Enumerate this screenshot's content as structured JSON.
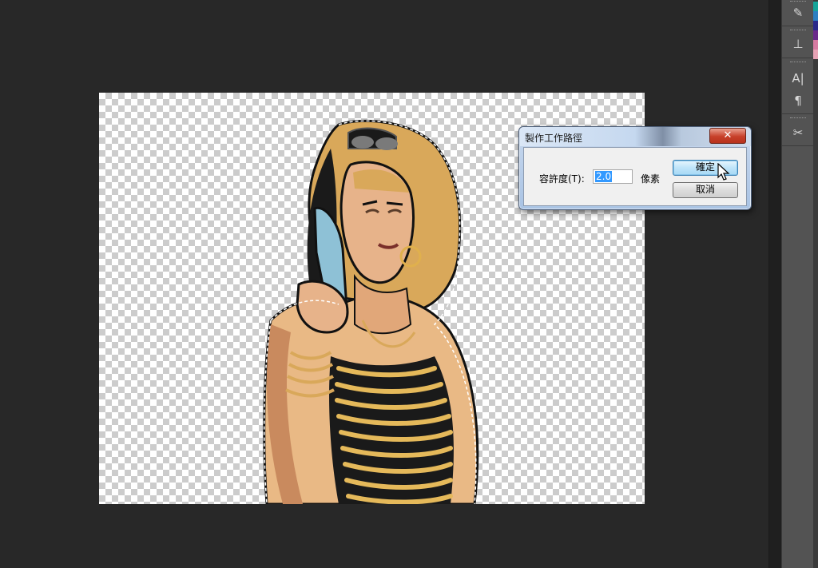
{
  "dialog": {
    "title": "製作工作路徑",
    "close_glyph": "✕",
    "tolerance_label": "容許度(T):",
    "tolerance_value": "2.0",
    "unit": "像素",
    "ok_label": "確定",
    "cancel_label": "取消"
  },
  "dock": {
    "tools": [
      {
        "icon": "brush-presets-icon",
        "glyph": "✎"
      },
      {
        "icon": "clone-source-icon",
        "glyph": "⊥"
      },
      {
        "icon": "character-icon",
        "glyph": "A|"
      },
      {
        "icon": "paragraph-icon",
        "glyph": "¶"
      },
      {
        "icon": "tool-presets-icon",
        "glyph": "✂"
      }
    ]
  },
  "swatches": [
    "#15a59a",
    "#2c7fc1",
    "#2a2a8a",
    "#6a2a8a",
    "#d77ba2",
    "#e7a3b5"
  ]
}
